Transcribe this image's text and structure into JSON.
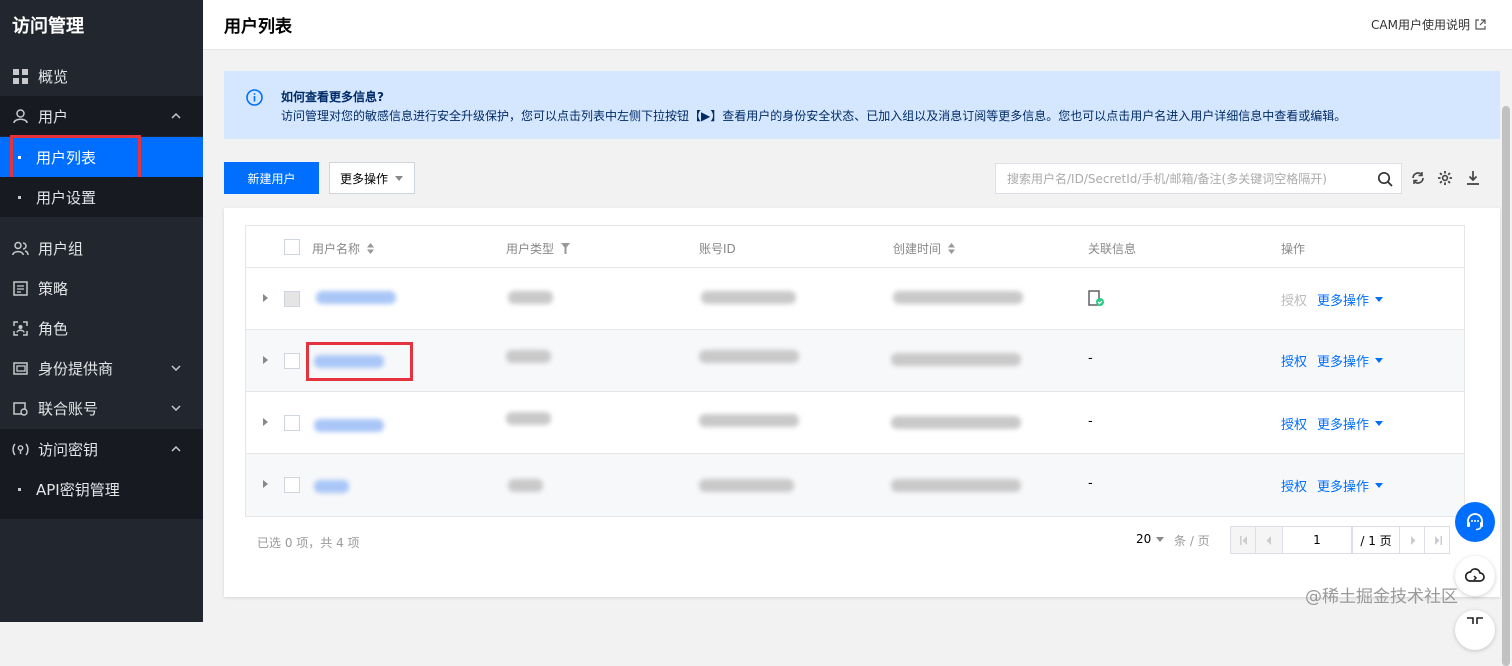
{
  "sidebar": {
    "title": "访问管理",
    "items": [
      {
        "label": "概览",
        "icon": "dashboard-icon"
      },
      {
        "label": "用户",
        "icon": "user-icon"
      },
      {
        "label": "用户列表"
      },
      {
        "label": "用户设置"
      },
      {
        "label": "用户组",
        "icon": "user-group-icon"
      },
      {
        "label": "策略",
        "icon": "policy-icon"
      },
      {
        "label": "角色",
        "icon": "role-icon"
      },
      {
        "label": "身份提供商",
        "icon": "identity-provider-icon"
      },
      {
        "label": "联合账号",
        "icon": "federated-account-icon"
      },
      {
        "label": "访问密钥",
        "icon": "access-key-icon"
      },
      {
        "label": "API密钥管理"
      }
    ]
  },
  "header": {
    "title": "用户列表",
    "help_link": "CAM用户使用说明"
  },
  "notice": {
    "title": "如何查看更多信息?",
    "text": "访问管理对您的敏感信息进行安全升级保护，您可以点击列表中左侧下拉按钮【▶】查看用户的身份安全状态、已加入组以及消息订阅等更多信息。您也可以点击用户名进入用户详细信息中查看或编辑。"
  },
  "toolbar": {
    "new_user": "新建用户",
    "more_actions": "更多操作",
    "search_placeholder": "搜索用户名/ID/SecretId/手机/邮箱/备注(多关键词空格隔开)"
  },
  "table": {
    "columns": [
      "用户名称",
      "用户类型",
      "账号ID",
      "创建时间",
      "关联信息",
      "操作"
    ],
    "rows": [
      {
        "linked": "",
        "authorize": "授权",
        "more": "更多操作",
        "authorize_disabled": true
      },
      {
        "linked": "-",
        "authorize": "授权",
        "more": "更多操作",
        "authorize_disabled": false
      },
      {
        "linked": "-",
        "authorize": "授权",
        "more": "更多操作",
        "authorize_disabled": false
      },
      {
        "linked": "-",
        "authorize": "授权",
        "more": "更多操作",
        "authorize_disabled": false
      }
    ]
  },
  "footer": {
    "selection": "已选 0 项，共 4 项",
    "page_size": "20",
    "page_size_unit": "条 / 页",
    "current_page": "1",
    "total_pages": "/ 1 页"
  },
  "watermark": "@稀土掘金技术社区",
  "colors": {
    "accent": "#006eff",
    "sidebar": "#22262e",
    "highlight": "#e5333d"
  }
}
